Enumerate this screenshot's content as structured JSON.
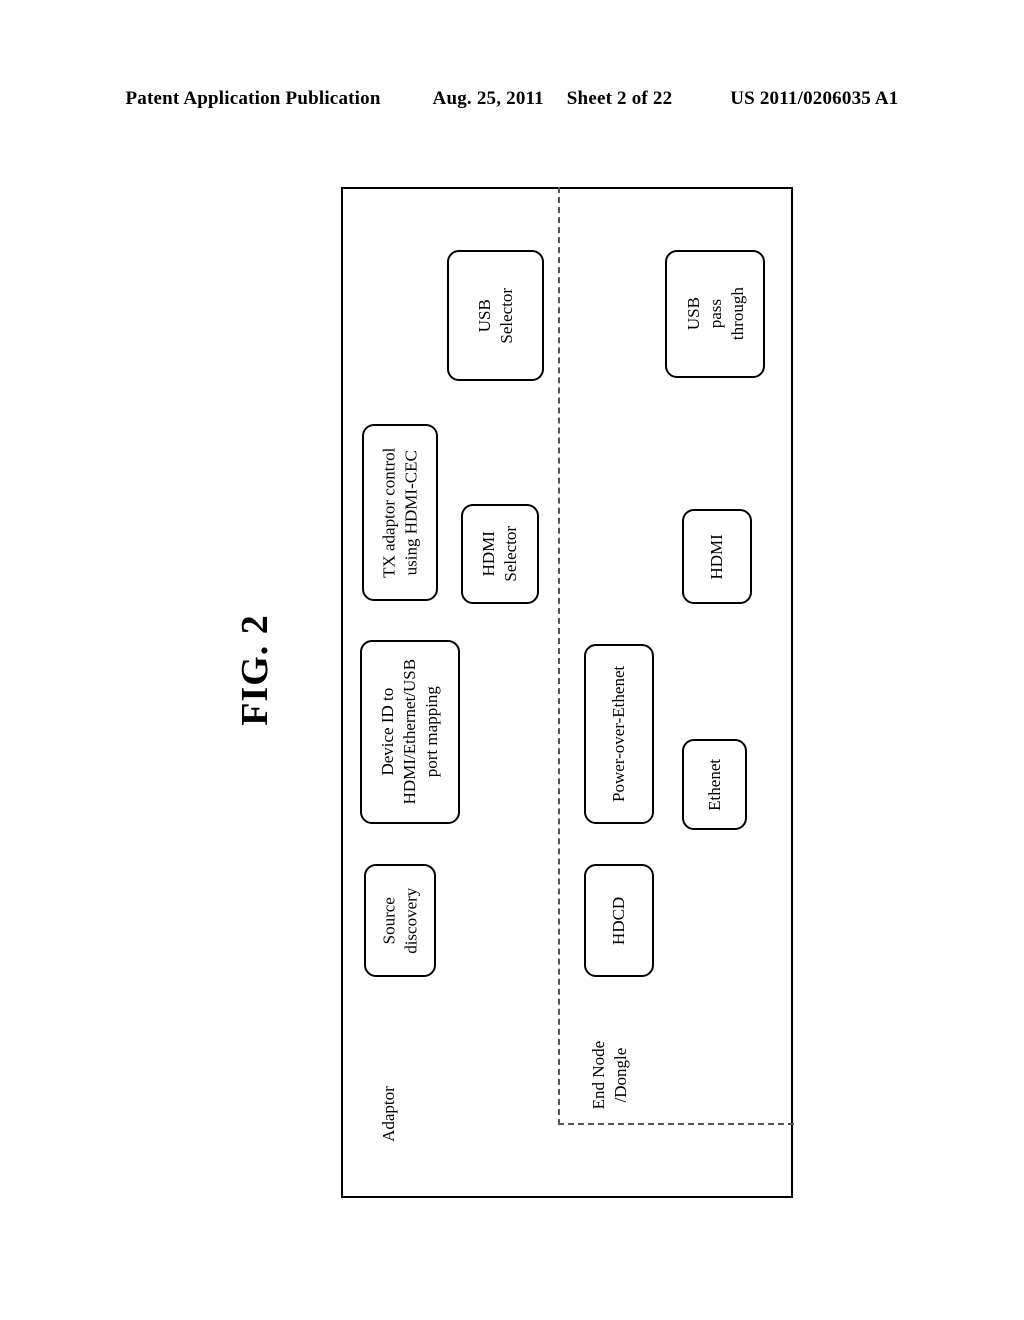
{
  "page_header": {
    "publication": "Patent Application Publication",
    "date": "Aug. 25, 2011",
    "sheet": "Sheet 2 of 22",
    "publication_number": "US 2011/0206035 A1"
  },
  "figure": {
    "label": "FIG. 2"
  },
  "diagram": {
    "outer_region_caption_line1": "Adaptor",
    "inner_region_caption_line1": "End Node",
    "inner_region_caption_line2": "/Dongle",
    "adaptor_blocks": [
      {
        "id": "usb-selector",
        "line1": "USB",
        "line2": "Selector"
      },
      {
        "id": "tx-adaptor-control",
        "line1": "TX adaptor control",
        "line2": "using HDMI-CEC"
      },
      {
        "id": "hdmi-selector",
        "line1": "HDMI",
        "line2": "Selector"
      },
      {
        "id": "device-id-mapping",
        "line1": "Device ID to",
        "line2": "HDMI/Ethernet/USB",
        "line3": "port mapping"
      },
      {
        "id": "source-discovery",
        "line1": "Source",
        "line2": "discovery"
      }
    ],
    "end_node_blocks": [
      {
        "id": "usb-pass-through",
        "line1": "USB",
        "line2": "pass",
        "line3": "through"
      },
      {
        "id": "hdmi",
        "line1": "HDMI"
      },
      {
        "id": "power-over-ethenet",
        "line1": "Power-over-Ethenet"
      },
      {
        "id": "ethenet",
        "line1": "Ethenet"
      },
      {
        "id": "hdcd",
        "line1": "HDCD"
      }
    ]
  },
  "colors": {
    "ink": "#000000",
    "paper": "#ffffff",
    "dashed_divider": "#555555"
  }
}
